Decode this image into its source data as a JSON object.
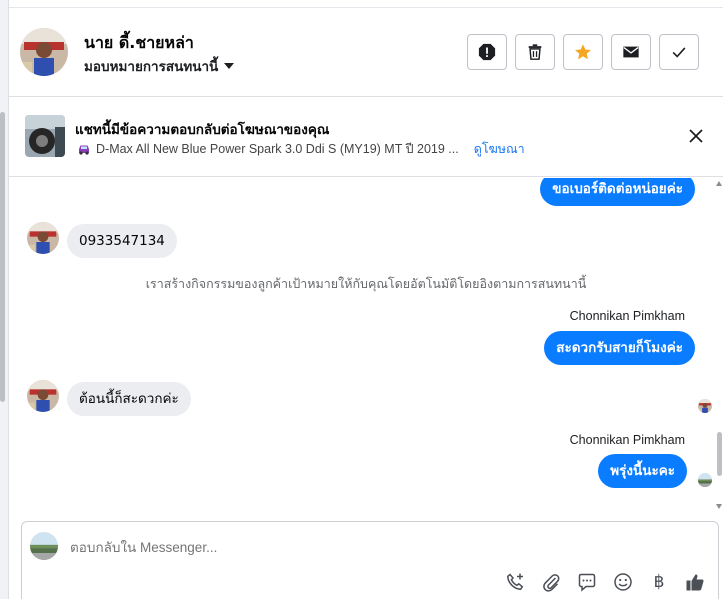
{
  "header": {
    "contact_name": "นาย ดี้.ชายหล่า",
    "assign_label": "มอบหมายการสนทนานี้",
    "actions": [
      "report-icon",
      "trash-icon",
      "star-icon",
      "mail-icon",
      "check-icon"
    ],
    "star_color": "#f5a623"
  },
  "ad": {
    "title": "แชทนี้มีข้อความตอบกลับต่อโฆษณาของคุณ",
    "car_description": "D-Max All New Blue Power Spark 3.0 Ddi S (MY19) MT ปี 2019 ...",
    "link_label": "ดูโฆษณา"
  },
  "messages": [
    {
      "type": "outgoing",
      "text": "ขอเบอร์ติดต่อหน่อยค่ะ"
    },
    {
      "type": "incoming",
      "text": "0933547134"
    },
    {
      "type": "system",
      "text": "เราสร้างกิจกรรมของลูกค้าเป้าหมายให้กับคุณโดยอัตโนมัติโดยอิงตามการสนทนานี้"
    },
    {
      "type": "outgoing",
      "sender": "Chonnikan Pimkham",
      "text": "สะดวกรับสายก็โมงค่ะ"
    },
    {
      "type": "incoming",
      "text": "ต้อนนี้ก็สะดวกค่ะ"
    },
    {
      "type": "outgoing",
      "sender": "Chonnikan Pimkham",
      "text": "พรุ่งนี้นะคะ"
    }
  ],
  "composer": {
    "placeholder": "ตอบกลับใน Messenger...",
    "tools": [
      "call-add-icon",
      "attachment-icon",
      "saved-reply-icon",
      "emoji-icon",
      "baht-icon",
      "like-icon"
    ],
    "baht_symbol": "฿"
  },
  "colors": {
    "accent": "#0a7cff",
    "link": "#1877f2",
    "incoming_bubble": "#ebedf0"
  }
}
